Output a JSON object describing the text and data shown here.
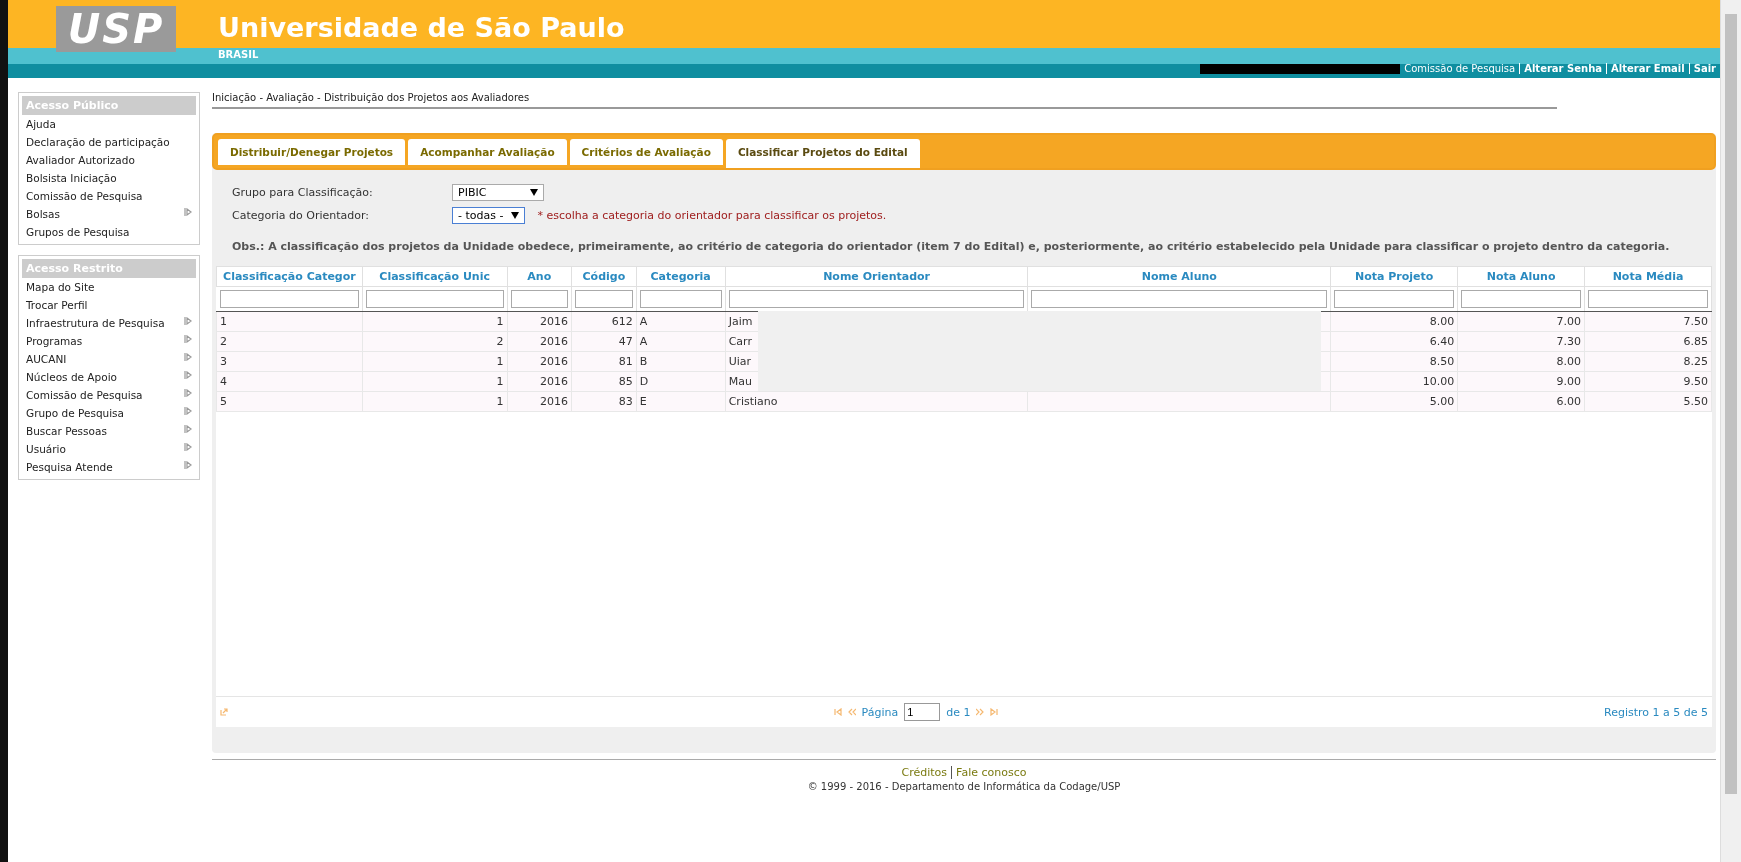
{
  "header": {
    "logo": "USP",
    "title": "Universidade de São Paulo",
    "subtitle": "BRASIL",
    "user_links": [
      {
        "label": "Comissão de Pesquisa",
        "bold": false
      },
      {
        "label": "Alterar Senha",
        "bold": true
      },
      {
        "label": "Alterar Email",
        "bold": true
      },
      {
        "label": "Sair",
        "bold": true
      }
    ]
  },
  "sidebar": [
    {
      "title": "Acesso Público",
      "items": [
        {
          "label": "Ajuda",
          "submenu": false
        },
        {
          "label": "Declaração de participação",
          "submenu": false
        },
        {
          "label": "Avaliador Autorizado",
          "submenu": false
        },
        {
          "label": "Bolsista Iniciação",
          "submenu": false
        },
        {
          "label": "Comissão de Pesquisa",
          "submenu": false
        },
        {
          "label": "Bolsas",
          "submenu": true
        },
        {
          "label": "Grupos de Pesquisa",
          "submenu": false
        }
      ]
    },
    {
      "title": "Acesso Restrito",
      "items": [
        {
          "label": "Mapa do Site",
          "submenu": false
        },
        {
          "label": "Trocar Perfil",
          "submenu": false
        },
        {
          "label": "Infraestrutura de Pesquisa",
          "submenu": true
        },
        {
          "label": "Programas",
          "submenu": true
        },
        {
          "label": "AUCANI",
          "submenu": true
        },
        {
          "label": "Núcleos de Apoio",
          "submenu": true
        },
        {
          "label": "Comissão de Pesquisa",
          "submenu": true
        },
        {
          "label": "Grupo de Pesquisa",
          "submenu": true
        },
        {
          "label": "Buscar Pessoas",
          "submenu": true
        },
        {
          "label": "Usuário",
          "submenu": true
        },
        {
          "label": "Pesquisa Atende",
          "submenu": true
        }
      ]
    }
  ],
  "breadcrumb": "Iniciação - Avaliação - Distribuição dos Projetos aos Avaliadores",
  "tabs": [
    {
      "label": "Distribuir/Denegar Projetos",
      "selected": false
    },
    {
      "label": "Acompanhar Avaliação",
      "selected": false
    },
    {
      "label": "Critérios de Avaliação",
      "selected": false
    },
    {
      "label": "Classificar Projetos do Edital",
      "selected": true
    }
  ],
  "form": {
    "group": {
      "label": "Grupo para Classificação:",
      "value": "PIBIC"
    },
    "category": {
      "label": "Categoria do Orientador:",
      "value": "- todas -",
      "hint": "* escolha a categoria do orientador para classificar os projetos."
    },
    "note": "Obs.: A classificação dos projetos da Unidade obedece, primeiramente, ao critério de categoria do orientador (item 7 do Edital) e, posteriormente, ao critério estabelecido pela Unidade para classificar o projeto dentro da categoria."
  },
  "table": {
    "columns": [
      "Classificação Categor",
      "Classificação Unic",
      "Ano",
      "Código",
      "Categoria",
      "Nome Orientador",
      "Nome Aluno",
      "Nota Projeto",
      "Nota Aluno",
      "Nota Média"
    ],
    "rows": [
      [
        "1",
        "1",
        "2016",
        "612",
        "A",
        "Jaim",
        "",
        "8.00",
        "7.00",
        "7.50"
      ],
      [
        "2",
        "2",
        "2016",
        "47",
        "A",
        "Carr",
        "",
        "6.40",
        "7.30",
        "6.85"
      ],
      [
        "3",
        "1",
        "2016",
        "81",
        "B",
        "Uiar",
        "",
        "8.50",
        "8.00",
        "8.25"
      ],
      [
        "4",
        "1",
        "2016",
        "85",
        "D",
        "Mau",
        "",
        "10.00",
        "9.00",
        "9.50"
      ],
      [
        "5",
        "1",
        "2016",
        "83",
        "E",
        "Cristiano",
        "",
        "5.00",
        "6.00",
        "5.50"
      ]
    ]
  },
  "pager": {
    "page_label": "Página",
    "page": "1",
    "of": "de 1",
    "records": "Registro 1 a 5 de 5"
  },
  "footer": {
    "links": [
      "Créditos",
      "Fale conosco"
    ],
    "copyright": "© 1999 - 2016 - Departamento de Informática da Codage/USP"
  }
}
